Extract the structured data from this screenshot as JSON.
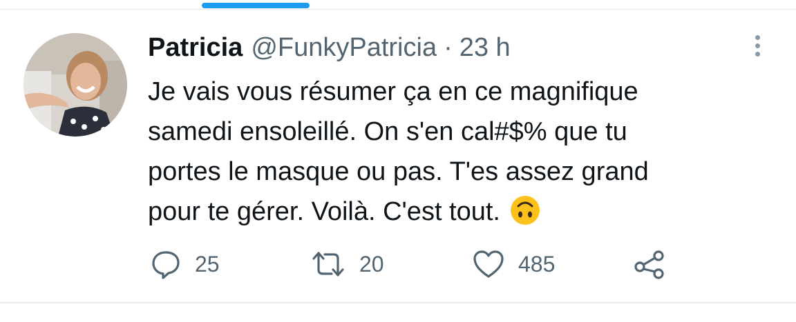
{
  "tweet": {
    "display_name": "Patricia",
    "handle": "@FunkyPatricia",
    "separator": "·",
    "time": "23 h",
    "text_lines": [
      "Je vais vous résumer ça en ce magnifique",
      "samedi ensoleillé. On s'en cal#$% que tu",
      "portes le masque ou pas. T'es assez grand",
      "pour te gérer. Voilà. C'est tout."
    ],
    "emoji": "upside-down-face-emoji"
  },
  "actions": {
    "replies": "25",
    "retweets": "20",
    "likes": "485"
  },
  "icons": {
    "more": "more-vertical-icon",
    "reply": "reply-icon",
    "retweet": "retweet-icon",
    "like": "heart-icon",
    "share": "share-icon"
  },
  "colors": {
    "accent": "#1d9bf0",
    "text_primary": "#0f1419",
    "text_secondary": "#536471",
    "divider": "#e6ecf0",
    "emoji_face": "#fcc21b"
  }
}
